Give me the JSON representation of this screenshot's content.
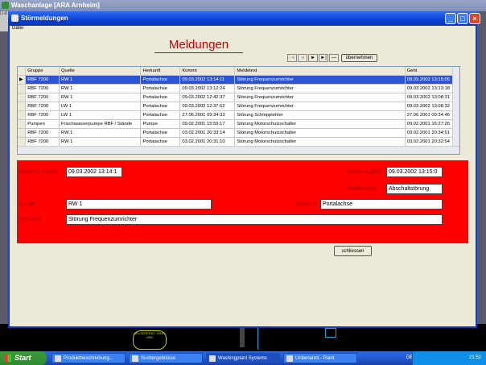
{
  "background_app": {
    "title": "Waschanlage [ARA Arnheim]",
    "menu_fragment": "Dat"
  },
  "background_canvas": {
    "label": "OELSEPERAT- IONS- UND"
  },
  "dialog": {
    "title": "Störmeldungen",
    "menu": [
      "Datei"
    ],
    "heading": "Meldungen",
    "nav_buttons": [
      "|◄",
      "◄",
      "►",
      "►|",
      "—"
    ],
    "apply_button": "übernehmen",
    "columns": [
      "Gruppe",
      "Quelle",
      "Herkunft",
      "Kommt",
      "Meldetext",
      "Geht"
    ],
    "rows": [
      [
        "RBF 7200",
        "RW 1",
        "Portalachse",
        "09.03.2002 13:14:11",
        "Störung Frequenzumrichter",
        "09.03.2002 13:15:05"
      ],
      [
        "RBF 7200",
        "RW 1",
        "Portalachse",
        "09.03.2002 13:12:24",
        "Störung Frequenzumrichter",
        "09.03.2002 13:13:18"
      ],
      [
        "RBF 7200",
        "RW 1",
        "Portalachse",
        "09.03.2002 12:42:37",
        "Störung Frequenzumrichter",
        "09.03.2002 13:08:31"
      ],
      [
        "RBF 7200",
        "LW 1",
        "Portalachse",
        "09.03.2002 12:37:52",
        "Störung Frequenzumrichter",
        "09.03.2002 13:08:32"
      ],
      [
        "RBF 7200",
        "LW 1",
        "Portalachse",
        "27.06.2001 09:34:33",
        "Störung Schlepptehler",
        "27.06.2001 09:34:46"
      ],
      [
        "Pumpen",
        "Frischwasserpumpe RBF / Stände",
        "Pumpe",
        "09.02.2001 15:59:17",
        "Störung Motorschutzschalter",
        "09.02.2001 16:27:26"
      ],
      [
        "RBF 7200",
        "RW 1",
        "Portalachse",
        "03.02.2001 20:33:14",
        "Störung Motorschutzschalter",
        "03.02.2001 20:34:51"
      ],
      [
        "RBF 7200",
        "RW 1",
        "Portalachse",
        "03.02.2001 20:31:10",
        "Störung Motorschutzschalter",
        "03.02.2001 20:32:54"
      ]
    ],
    "selected_row": 0,
    "detail": {
      "kommt_label": "Meldung kommt",
      "kommt_value": "09.03.2002 13:14:1",
      "geht_label": "Meldung geht",
      "geht_value": "09.03.2002 13:15:0",
      "art_label": "Meldungsart",
      "art_value": "Abschaltstörung",
      "quelle_label": "Quelle",
      "quelle_value": "RW 1",
      "herkunft_label": "Herkunft",
      "herkunft_value": "Portalachse",
      "meldung_label": "Meldung",
      "meldung_value": "Störung Frequenzumrichter"
    },
    "close_button": "schliessen"
  },
  "taskbar": {
    "start": "Start",
    "tasks": [
      "Produktbeschreibung...",
      "Suchergebnisse",
      "Washingplant Systems",
      "Unbenannt - Paint"
    ],
    "language": "DE",
    "clock": "21:52"
  }
}
